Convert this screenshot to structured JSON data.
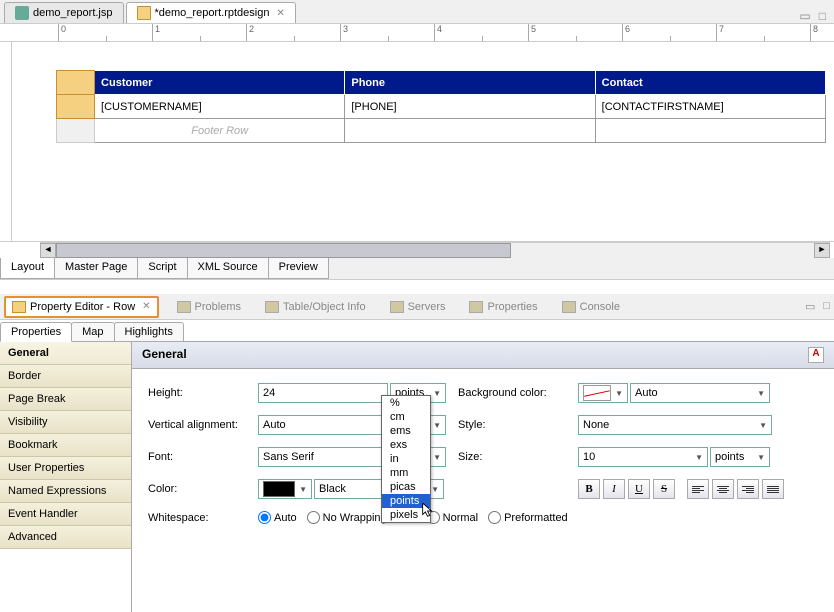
{
  "tabs": {
    "jsp": "demo_report.jsp",
    "rpt": "*demo_report.rptdesign"
  },
  "ruler": [
    "0",
    "1",
    "2",
    "3",
    "4",
    "5",
    "6",
    "7",
    "8"
  ],
  "table": {
    "headers": [
      "Customer",
      "Phone",
      "Contact"
    ],
    "detail": [
      "[CUSTOMERNAME]",
      "[PHONE]",
      "[CONTACTFIRSTNAME]"
    ],
    "footer": "Footer Row"
  },
  "editor_tabs": [
    "Layout",
    "Master Page",
    "Script",
    "XML Source",
    "Preview"
  ],
  "views": {
    "prop_editor": "Property Editor - Row",
    "problems": "Problems",
    "table_info": "Table/Object Info",
    "servers": "Servers",
    "properties": "Properties",
    "console": "Console"
  },
  "prop_subtabs": [
    "Properties",
    "Map",
    "Highlights"
  ],
  "prop_nav": [
    "General",
    "Border",
    "Page Break",
    "Visibility",
    "Bookmark",
    "User Properties",
    "Named Expressions",
    "Event Handler",
    "Advanced"
  ],
  "general": {
    "title": "General",
    "height_label": "Height:",
    "height_value": "24",
    "height_unit": "points",
    "valign_label": "Vertical alignment:",
    "valign_value": "Auto",
    "font_label": "Font:",
    "font_value": "Sans Serif",
    "color_label": "Color:",
    "color_value": "Black",
    "whitespace_label": "Whitespace:",
    "ws_auto": "Auto",
    "ws_nowrap": "No Wrapping",
    "ws_normal": "Normal",
    "ws_pre": "Preformatted",
    "bgcolor_label": "Background color:",
    "bgcolor_value": "Auto",
    "style_label": "Style:",
    "style_value": "None",
    "size_label": "Size:",
    "size_value": "10",
    "size_unit": "points"
  },
  "unit_options": [
    "%",
    "cm",
    "ems",
    "exs",
    "in",
    "mm",
    "picas",
    "points",
    "pixels"
  ],
  "unit_selected": "points"
}
